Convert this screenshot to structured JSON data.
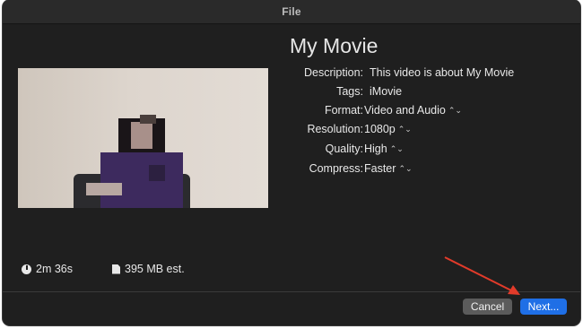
{
  "window": {
    "title": "File"
  },
  "movie": {
    "title": "My Movie"
  },
  "fields": [
    {
      "label": "Description:",
      "value": "This video is about My Movie",
      "dropdown": false
    },
    {
      "label": "Tags:",
      "value": "iMovie",
      "dropdown": false
    },
    {
      "label": "Format:",
      "value": "Video and Audio",
      "dropdown": true
    },
    {
      "label": "Resolution:",
      "value": "1080p",
      "dropdown": true
    },
    {
      "label": "Quality:",
      "value": "High",
      "dropdown": true
    },
    {
      "label": "Compress:",
      "value": "Faster",
      "dropdown": true
    }
  ],
  "stats": {
    "duration": "2m 36s",
    "size": "395 MB est."
  },
  "buttons": {
    "cancel": "Cancel",
    "next": "Next..."
  },
  "icons": {
    "duration": "clock-icon",
    "size": "file-icon",
    "dropdown": "updown-chevron-icon"
  },
  "colors": {
    "accent": "#1f6fe6",
    "annotation": "#e23b2a"
  }
}
